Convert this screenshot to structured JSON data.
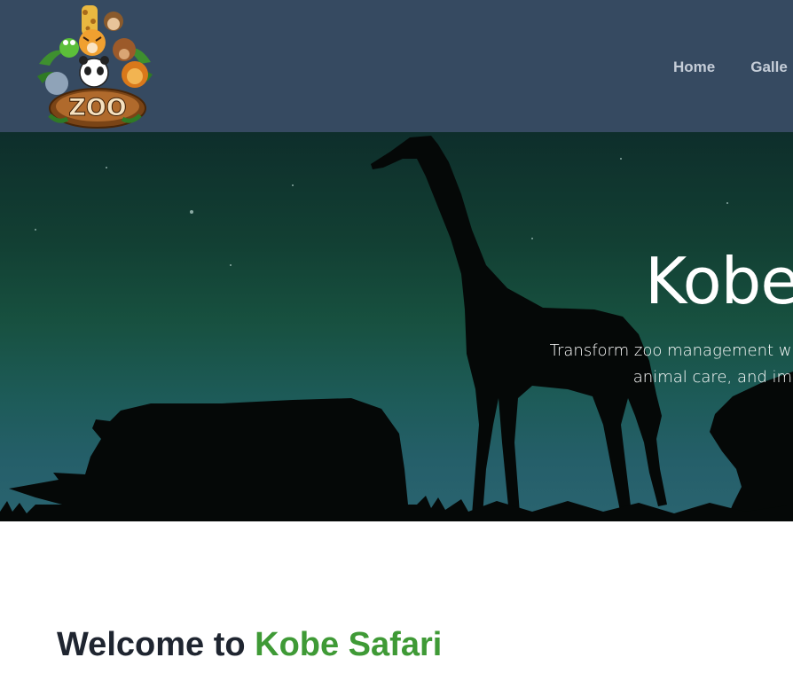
{
  "logo": {
    "text": "ZOO",
    "icon": "zoo-animals-logo"
  },
  "nav": {
    "items": [
      {
        "label": "Home"
      },
      {
        "label": "Galle"
      }
    ]
  },
  "hero": {
    "title": "Kobe",
    "subtitle_line1": "Transform zoo management with Kobe Safari's",
    "subtitle_line2": "animal care, and improve"
  },
  "welcome": {
    "prefix": "Welcome to ",
    "brand": "Kobe Safari"
  },
  "colors": {
    "header_bg": "#364a61",
    "nav_text": "#c5cdd8",
    "hero_top": "#0e2e2b",
    "hero_bottom": "#2a6470",
    "accent_green": "#3f9a36",
    "heading_dark": "#1f2530"
  }
}
